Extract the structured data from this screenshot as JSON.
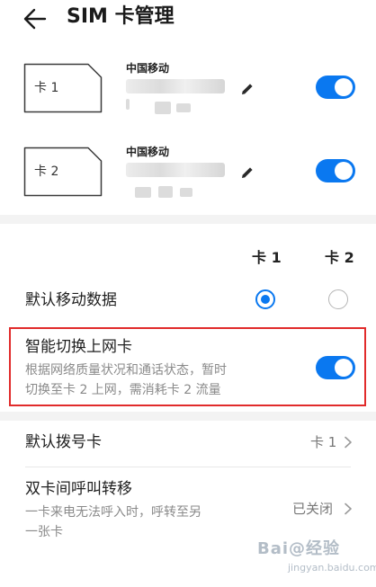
{
  "header": {
    "title": "SIM 卡管理"
  },
  "sims": [
    {
      "label": "卡 1",
      "carrier": "中国移动",
      "enabled": true
    },
    {
      "label": "卡 2",
      "carrier": "中国移动",
      "enabled": true
    }
  ],
  "columns": {
    "card1": "卡 1",
    "card2": "卡 2"
  },
  "default_data": {
    "title": "默认移动数据",
    "selected": "card1"
  },
  "smart_switch": {
    "title": "智能切换上网卡",
    "desc_line1": "根据网络质量状况和通话状态，暂时",
    "desc_line2": "切换至卡 2 上网，需消耗卡 2 流量",
    "enabled": true
  },
  "default_dial": {
    "title": "默认拨号卡",
    "value": "卡 1"
  },
  "call_forward": {
    "title": "双卡间呼叫转移",
    "desc_line1": "一卡来电无法呼入时，呼转至另",
    "desc_line2": "一张卡",
    "value": "已关闭"
  },
  "watermark": {
    "logo": "Bai@经验",
    "url": "jingyan.baidu.com"
  },
  "colors": {
    "accent": "#0a78f0",
    "highlight": "#e12b2b"
  }
}
